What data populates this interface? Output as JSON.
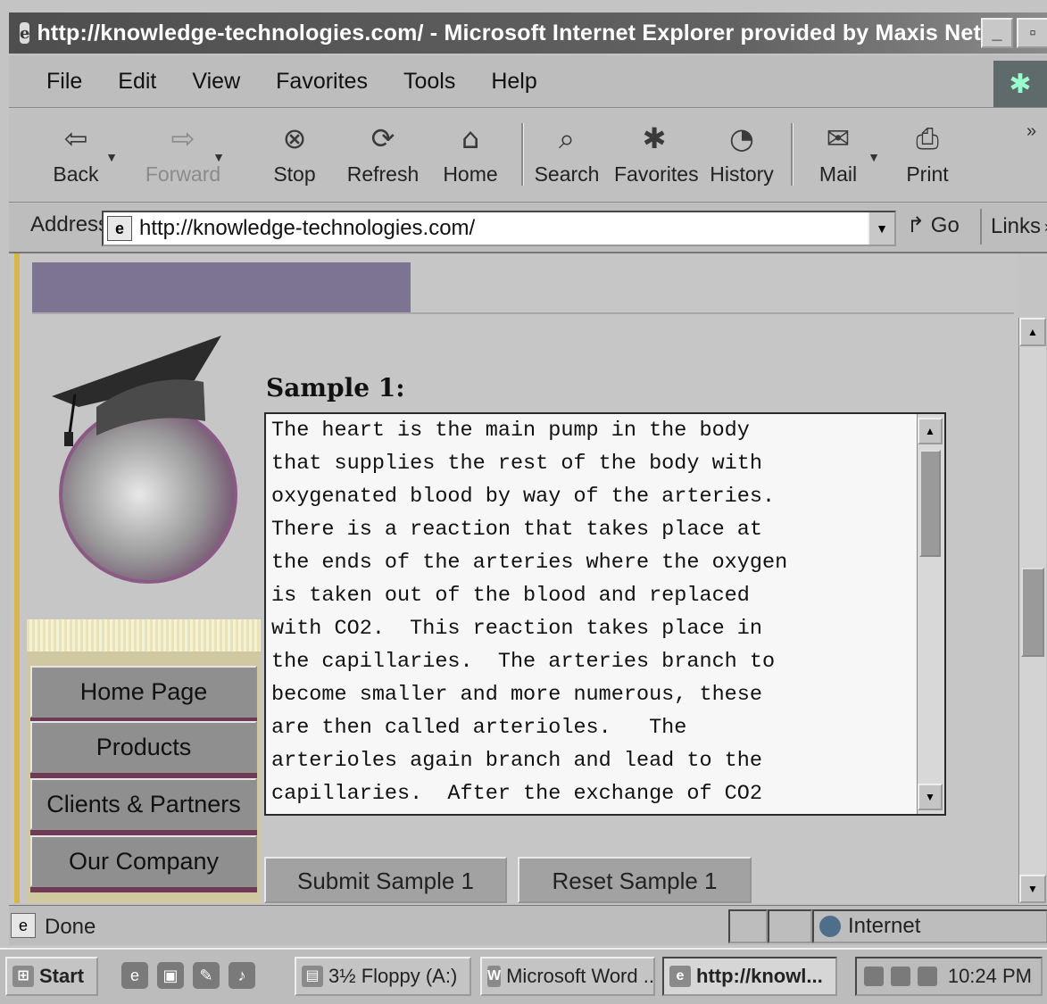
{
  "window": {
    "title": "http://knowledge-technologies.com/ - Microsoft Internet Explorer provided by Maxis Net"
  },
  "menu": [
    "File",
    "Edit",
    "View",
    "Favorites",
    "Tools",
    "Help"
  ],
  "toolbar": {
    "back": "Back",
    "forward": "Forward",
    "stop": "Stop",
    "refresh": "Refresh",
    "home": "Home",
    "search": "Search",
    "favorites": "Favorites",
    "history": "History",
    "mail": "Mail",
    "print": "Print"
  },
  "address": {
    "label": "Address",
    "url": "http://knowledge-technologies.com/",
    "go": "Go",
    "links": "Links"
  },
  "page": {
    "nav": [
      "Home Page",
      "Products",
      "Clients & Partners",
      "Our Company"
    ],
    "sample_title": "Sample 1:",
    "sample_text": "The heart is the main pump in the body\nthat supplies the rest of the body with\noxygenated blood by way of the arteries.\nThere is a reaction that takes place at\nthe ends of the arteries where the oxygen\nis taken out of the blood and replaced\nwith CO2.  This reaction takes place in\nthe capillaries.  The arteries branch to\nbecome smaller and more numerous, these\nare then called arterioles.   The\narterioles again branch and lead to the\ncapillaries.  After the exchange of CO2",
    "submit": "Submit Sample 1",
    "reset": "Reset Sample 1"
  },
  "status": {
    "text": "Done",
    "zone": "Internet"
  },
  "taskbar": {
    "start": "Start",
    "items": [
      "3½ Floppy (A:)",
      "Microsoft Word ...",
      "http://knowl..."
    ],
    "clock": "10:24 PM"
  },
  "icons": {
    "back": "back-arrow-icon",
    "forward": "forward-arrow-icon",
    "stop": "stop-icon",
    "refresh": "refresh-icon",
    "home": "home-icon",
    "search": "search-icon",
    "favorites": "favorites-icon",
    "history": "history-icon",
    "mail": "mail-icon",
    "print": "print-icon",
    "go": "go-arrow-icon"
  }
}
